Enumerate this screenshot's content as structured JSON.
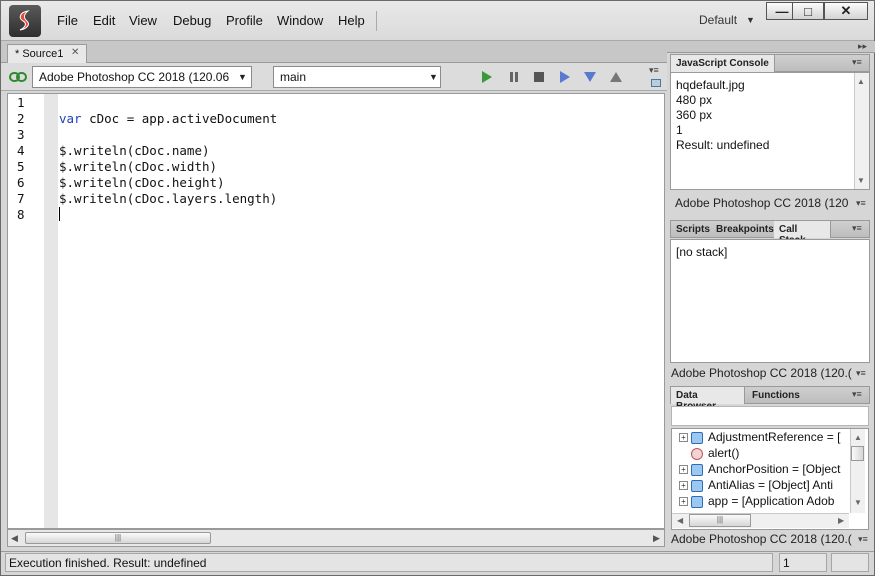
{
  "menubar": {
    "items": [
      "File",
      "Edit",
      "View",
      "Debug",
      "Profile",
      "Window",
      "Help"
    ],
    "workspace": "Default",
    "window_buttons": [
      "minimize",
      "maximize",
      "close"
    ]
  },
  "editor": {
    "tab_label": "* Source1",
    "target_app": "Adobe Photoshop CC 2018 (120.06",
    "engine": "main",
    "line_numbers": [
      "1",
      "2",
      "3",
      "4",
      "5",
      "6",
      "7",
      "8"
    ],
    "lines": [
      {
        "kw": "",
        "text": ""
      },
      {
        "kw": "var",
        "text": " cDoc = app.activeDocument"
      },
      {
        "kw": "",
        "text": ""
      },
      {
        "kw": "",
        "text": "$.writeln(cDoc.name)"
      },
      {
        "kw": "",
        "text": "$.writeln(cDoc.width)"
      },
      {
        "kw": "",
        "text": "$.writeln(cDoc.height)"
      },
      {
        "kw": "",
        "text": "$.writeln(cDoc.layers.length)"
      },
      {
        "kw": "",
        "text": ""
      }
    ]
  },
  "console": {
    "title": "JavaScript Console",
    "output": [
      "hqdefault.jpg",
      "480 px",
      "360 px",
      "1",
      "Result: undefined"
    ],
    "footer": "Adobe Photoshop CC 2018 (120"
  },
  "callstack": {
    "tabs": [
      "Scripts",
      "Breakpoints",
      "Call Stack"
    ],
    "content": "[no stack]",
    "footer": "Adobe Photoshop CC 2018 (120.("
  },
  "databrowser": {
    "tabs": [
      "Data Browser",
      "Functions"
    ],
    "rows": [
      {
        "icon": "cube",
        "expand": true,
        "text": "AdjustmentReference = ["
      },
      {
        "icon": "function",
        "expand": false,
        "text": "alert()"
      },
      {
        "icon": "cube",
        "expand": true,
        "text": "AnchorPosition = [Object"
      },
      {
        "icon": "cube",
        "expand": true,
        "text": "AntiAlias = [Object] Anti"
      },
      {
        "icon": "cube",
        "expand": true,
        "text": "app = [Application Adob"
      }
    ],
    "footer": "Adobe Photoshop CC 2018 (120.("
  },
  "status": {
    "message": "Execution finished. Result: undefined",
    "line": "1"
  }
}
